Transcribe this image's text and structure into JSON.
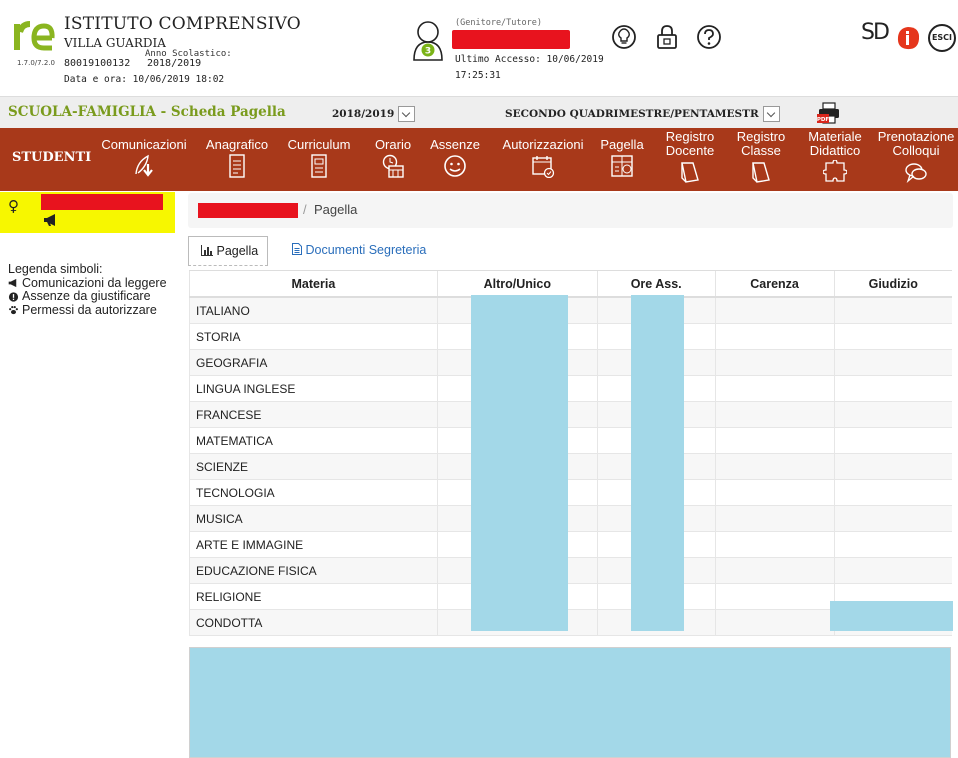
{
  "header": {
    "version": "1.7.0/7.2.0",
    "institute_title": "ISTITUTO COMPRENSIVO",
    "institute_subtitle": "VILLA GUARDIA",
    "code": "80019100132",
    "school_year_label": "Anno Scolastico:",
    "school_year_value": "2018/2019",
    "datetime": "Data e ora: 10/06/2019 18:02",
    "user_role": "(Genitore/Tutore)",
    "notification_count": "3",
    "last_access_label": "Ultimo Accesso: 10/06/2019",
    "last_access_time": "17:25:31",
    "sd_logo": "SD",
    "esci_label": "ESCI",
    "icons": [
      "lightbulb-icon",
      "lock-icon",
      "help-icon",
      "sd-logo",
      "spaggiari-logo",
      "logout-icon"
    ]
  },
  "subheader": {
    "title": "SCUOLA-FAMIGLIA - Scheda Pagella",
    "year_select": "2018/2019",
    "period_select": "SECONDO QUADRIMESTRE/PENTAMESTR",
    "pdf_icon": "pdf-print-icon"
  },
  "nav": {
    "section": "STUDENTI",
    "items": [
      {
        "label1": "Comunicazioni",
        "label2": "",
        "icon": "feather-download-icon"
      },
      {
        "label1": "Anagrafico",
        "label2": "",
        "icon": "document-icon"
      },
      {
        "label1": "Curriculum",
        "label2": "",
        "icon": "list-document-icon"
      },
      {
        "label1": "Orario",
        "label2": "",
        "icon": "clock-calendar-icon"
      },
      {
        "label1": "Assenze",
        "label2": "",
        "icon": "smiley-icon"
      },
      {
        "label1": "Autorizzazioni",
        "label2": "",
        "icon": "calendar-check-icon"
      },
      {
        "label1": "Pagella",
        "label2": "",
        "icon": "report-card-icon"
      },
      {
        "label1": "Registro",
        "label2": "Docente",
        "icon": "book-icon"
      },
      {
        "label1": "Registro",
        "label2": "Classe",
        "icon": "book-icon"
      },
      {
        "label1": "Materiale",
        "label2": "Didattico",
        "icon": "puzzle-icon"
      },
      {
        "label1": "Prenotazione",
        "label2": "Colloqui",
        "icon": "chat-icon"
      }
    ]
  },
  "sidebar": {
    "legend_title": "Legenda simboli:",
    "legend_items": [
      {
        "icon": "megaphone-icon",
        "text": "Comunicazioni da leggere"
      },
      {
        "icon": "exclamation-circle-icon",
        "text": "Assenze da giustificare"
      },
      {
        "icon": "paw-icon",
        "text": "Permessi da autorizzare"
      }
    ]
  },
  "breadcrumb": {
    "separator": "/",
    "current": "Pagella"
  },
  "tabs": [
    {
      "label": "Pagella",
      "icon": "bar-chart-icon"
    },
    {
      "label": "Documenti Segreteria",
      "icon": "file-text-icon"
    }
  ],
  "table": {
    "headers": [
      "Materia",
      "Altro/Unico",
      "Ore Ass.",
      "Carenza",
      "Giudizio"
    ],
    "rows": [
      "ITALIANO",
      "STORIA",
      "GEOGRAFIA",
      "LINGUA INGLESE",
      "FRANCESE",
      "MATEMATICA",
      "SCIENZE",
      "TECNOLOGIA",
      "MUSICA",
      "ARTE E IMMAGINE",
      "EDUCAZIONE FISICA",
      "RELIGIONE",
      "CONDOTTA"
    ]
  },
  "colors": {
    "nav_bg": "#a8391a",
    "accent_green": "#7a9b1d",
    "redaction": "#e8131e",
    "highlight_yellow": "#f7f700",
    "masked_blue": "#a3d8e8"
  }
}
